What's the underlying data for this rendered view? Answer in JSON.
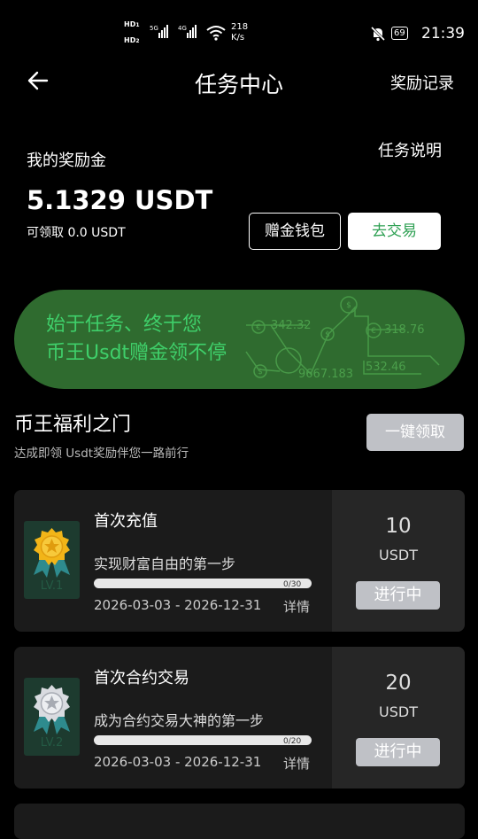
{
  "status_bar": {
    "hd1": "HD",
    "hd1_sub": "1",
    "hd2": "HD",
    "hd2_sub": "2",
    "net1": "5G",
    "net2": "4G",
    "speed_value": "218",
    "speed_unit": "K/s",
    "battery": "69",
    "time": "21:39"
  },
  "header": {
    "title": "任务中心",
    "right_link": "奖励记录"
  },
  "reward": {
    "label": "我的奖励金",
    "help_link": "任务说明",
    "amount": "5.1329 USDT",
    "claimable": "可领取  0.0 USDT",
    "wallet_button": "赠金钱包",
    "trade_button": "去交易"
  },
  "banner": {
    "line1": "始于任务、终于您",
    "line2": "币王Usdt赠金领不停",
    "numbers": [
      "342.32",
      "318.76",
      "9667.183",
      "532.46"
    ],
    "symbols": [
      "$",
      "€",
      "$",
      "€",
      "$"
    ]
  },
  "section": {
    "title": "币王福利之门",
    "subtitle": "达成即领 Usdt奖励伴您一路前行",
    "claim_all_button": "一键领取"
  },
  "tasks": [
    {
      "title": "首次充值",
      "desc": "实现财富自由的第一步",
      "progress_text": "0/30",
      "progress": 0,
      "dates": "2026-03-03 - 2026-12-31",
      "details": "详情",
      "level": "LV.1",
      "medal_color": "#f2b518",
      "reward_value": "10",
      "reward_unit": "USDT",
      "status": "进行中"
    },
    {
      "title": "首次合约交易",
      "desc": "成为合约交易大神的第一步",
      "progress_text": "0/20",
      "progress": 0,
      "dates": "2026-03-03 - 2026-12-31",
      "details": "详情",
      "level": "LV.2",
      "medal_color": "#c9ccd1",
      "reward_value": "20",
      "reward_unit": "USDT",
      "status": "进行中"
    }
  ],
  "colors": {
    "accent_green": "#2ea053",
    "banner_bg": "#2f6b2f",
    "banner_text": "#3fcf6a",
    "card_bg": "#1b1b1b"
  }
}
